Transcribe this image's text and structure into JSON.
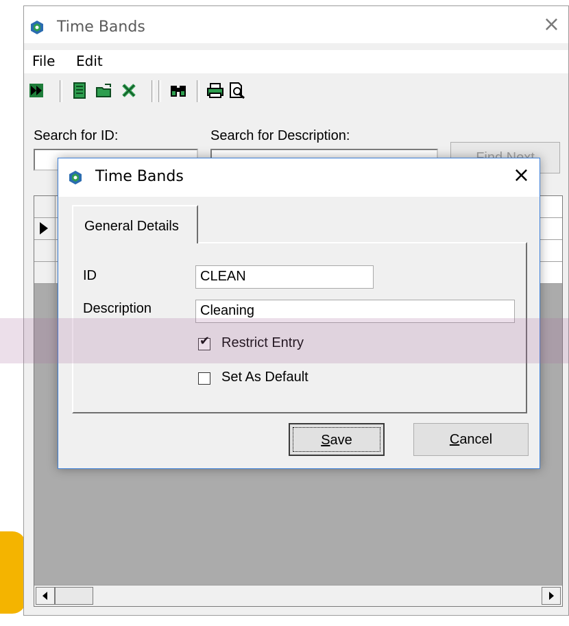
{
  "main_window": {
    "title": "Time Bands",
    "menu": [
      "File",
      "Edit"
    ],
    "toolbar_icons": [
      "exit-icon",
      "new-record-icon",
      "open-folder-icon",
      "delete-icon",
      "find-binoculars-icon",
      "print-icon",
      "print-preview-icon"
    ],
    "search_id_label": "Search for ID:",
    "search_id_value": "",
    "search_desc_label": "Search for Description:",
    "search_desc_value": "",
    "find_next_label": "Find Next"
  },
  "dialog": {
    "title": "Time Bands",
    "tab_label": "General Details",
    "id_label": "ID",
    "id_value": "CLEAN",
    "description_label": "Description",
    "description_value": "Cleaning",
    "restrict_entry_label": "Restrict Entry",
    "restrict_entry_checked": true,
    "set_as_default_label": "Set As Default",
    "set_as_default_checked": false,
    "save_label_rest": "ave",
    "save_label_key": "S",
    "cancel_label_key": "C",
    "cancel_label_rest": "ancel"
  },
  "colors": {
    "accent": "#3c7fd8",
    "highlight": "#c8a0c0",
    "logo_green": "#2e9e4f",
    "logo_blue": "#2b6cb0"
  }
}
